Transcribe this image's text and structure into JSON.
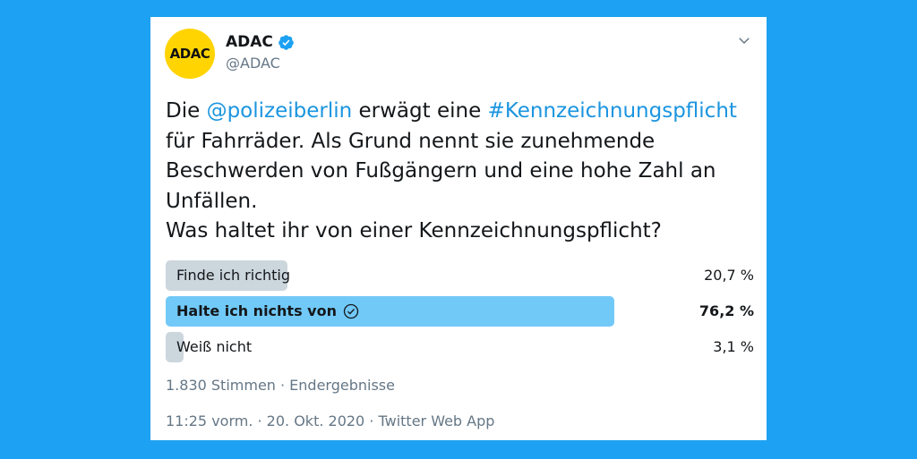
{
  "user": {
    "avatar_text": "ADAC",
    "display_name": "ADAC",
    "handle": "@ADAC"
  },
  "tweet": {
    "t1": "Die ",
    "mention": "@polizeiberlin",
    "t2": " erwägt eine ",
    "hashtag": "#Kennzeichnungspflicht",
    "t3": " für Fahrräder. Als Grund nennt sie zunehmende Beschwerden von Fußgängern und eine hohe Zahl an Unfällen.",
    "line2": "Was haltet ihr von einer Kennzeichnungspflicht?"
  },
  "poll": {
    "options": [
      {
        "label": "Finde ich richtig",
        "percent_text": "20,7 %",
        "percent": 20.7,
        "winner": false
      },
      {
        "label": "Halte ich nichts von",
        "percent_text": "76,2 %",
        "percent": 76.2,
        "winner": true
      },
      {
        "label": "Weiß nicht",
        "percent_text": "3,1 %",
        "percent": 3.1,
        "winner": false
      }
    ],
    "meta": "1.830 Stimmen · Endergebnisse"
  },
  "timestamp": "11:25 vorm. · 20. Okt. 2020 · Twitter Web App",
  "colors": {
    "background": "#1da1f2",
    "link": "#1b95e0",
    "bar": "#ccd6dd",
    "bar_winner": "#71c9f8",
    "avatar": "#ffd400"
  }
}
